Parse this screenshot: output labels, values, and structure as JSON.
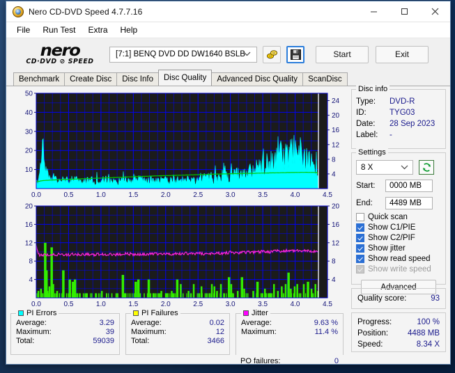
{
  "window": {
    "title": "Nero CD-DVD Speed 4.7.7.16",
    "icon": "nero-disc-icon",
    "minimize": "minimize-icon",
    "maximize": "maximize-icon",
    "close": "close-icon"
  },
  "menu": [
    {
      "label": "File"
    },
    {
      "label": "Run Test"
    },
    {
      "label": "Extra"
    },
    {
      "label": "Help"
    }
  ],
  "toolbar": {
    "logo_word": "nero",
    "logo_sub": "CD·DVD ⊘ SPEED",
    "drive": "[7:1]   BENQ DVD DD DW1640 BSLB",
    "eject_icon": "eject-disc-icon",
    "save_icon": "floppy-save-icon",
    "start_label": "Start",
    "exit_label": "Exit"
  },
  "tabs": [
    {
      "label": "Benchmark",
      "active": false
    },
    {
      "label": "Create Disc",
      "active": false
    },
    {
      "label": "Disc Info",
      "active": false
    },
    {
      "label": "Disc Quality",
      "active": true
    },
    {
      "label": "Advanced Disc Quality",
      "active": false
    },
    {
      "label": "ScanDisc",
      "active": false
    }
  ],
  "disc_info": {
    "title": "Disc info",
    "rows": [
      {
        "key": "Type:",
        "value": "DVD-R"
      },
      {
        "key": "ID:",
        "value": "TYG03"
      },
      {
        "key": "Date:",
        "value": "28 Sep 2023"
      },
      {
        "key": "Label:",
        "value": "-"
      }
    ]
  },
  "settings": {
    "title": "Settings",
    "speed": "8 X",
    "refresh_icon": "refresh-arrows-icon",
    "start_label": "Start:",
    "start_value": "0000 MB",
    "end_label": "End:",
    "end_value": "4489 MB",
    "checkboxes": [
      {
        "label": "Quick scan",
        "checked": false,
        "disabled": false
      },
      {
        "label": "Show C1/PIE",
        "checked": true,
        "disabled": false
      },
      {
        "label": "Show C2/PIF",
        "checked": true,
        "disabled": false
      },
      {
        "label": "Show jitter",
        "checked": true,
        "disabled": false
      },
      {
        "label": "Show read speed",
        "checked": true,
        "disabled": false
      },
      {
        "label": "Show write speed",
        "checked": true,
        "disabled": true
      }
    ],
    "advanced_label": "Advanced"
  },
  "quality": {
    "label": "Quality score:",
    "value": "93"
  },
  "progress": {
    "rows": [
      {
        "key": "Progress:",
        "value": "100 %"
      },
      {
        "key": "Position:",
        "value": "4488 MB"
      },
      {
        "key": "Speed:",
        "value": "8.34 X"
      }
    ]
  },
  "stats": {
    "pi_errors": {
      "title": "PI Errors",
      "color": "#00ffff",
      "rows": [
        {
          "key": "Average:",
          "value": "3.29"
        },
        {
          "key": "Maximum:",
          "value": "39"
        },
        {
          "key": "Total:",
          "value": "59039"
        }
      ]
    },
    "pi_failures": {
      "title": "PI Failures",
      "color": "#ffff00",
      "rows": [
        {
          "key": "Average:",
          "value": "0.02"
        },
        {
          "key": "Maximum:",
          "value": "12"
        },
        {
          "key": "Total:",
          "value": "3466"
        }
      ]
    },
    "jitter": {
      "title": "Jitter",
      "color": "#ff00ff",
      "rows": [
        {
          "key": "Average:",
          "value": "9.63 %"
        },
        {
          "key": "Maximum:",
          "value": "11.4 %"
        }
      ],
      "po_key": "PO failures:",
      "po_value": "0"
    }
  },
  "chart_data": [
    {
      "type": "area",
      "name": "pi-errors-chart",
      "title": "",
      "xlabel": "",
      "ylabel": "PI Errors",
      "xlim": [
        0.0,
        4.5
      ],
      "ylim": [
        0,
        50
      ],
      "y2lim": [
        0,
        26
      ],
      "xticks": [
        0.0,
        0.5,
        1.0,
        1.5,
        2.0,
        2.5,
        3.0,
        3.5,
        4.0,
        4.5
      ],
      "yticks": [
        10,
        20,
        30,
        40,
        50
      ],
      "y2ticks": [
        4,
        8,
        12,
        16,
        20,
        24
      ],
      "grid": true,
      "bg": "#1b1b1b",
      "grid_color": "#0000ff",
      "scan_end_x": 4.36,
      "series": [
        {
          "name": "PI Errors",
          "color": "#00ffff",
          "kind": "area",
          "x": [
            0.0,
            0.04,
            0.07,
            0.1,
            0.12,
            0.14,
            0.16,
            0.19,
            0.23,
            0.27,
            0.31,
            0.36,
            0.42,
            0.48,
            0.55,
            0.62,
            0.7,
            0.78,
            0.86,
            0.94,
            1.02,
            1.1,
            1.18,
            1.26,
            1.34,
            1.42,
            1.5,
            1.58,
            1.66,
            1.74,
            1.82,
            1.9,
            1.98,
            2.06,
            2.14,
            2.22,
            2.3,
            2.38,
            2.46,
            2.54,
            2.62,
            2.7,
            2.78,
            2.86,
            2.94,
            3.02,
            3.1,
            3.18,
            3.26,
            3.34,
            3.42,
            3.5,
            3.58,
            3.66,
            3.74,
            3.82,
            3.86,
            3.9,
            3.98,
            4.02,
            4.06,
            4.1,
            4.14,
            4.18,
            4.22,
            4.26,
            4.3,
            4.34,
            4.36
          ],
          "y": [
            2,
            5,
            11,
            20,
            13,
            9,
            7,
            6,
            5,
            5,
            4,
            4,
            4,
            4,
            4,
            4,
            4,
            4,
            4,
            4,
            4,
            4,
            4,
            4,
            4,
            4,
            4,
            4,
            4,
            4,
            4,
            4,
            4,
            4,
            4,
            4,
            4,
            4,
            4,
            5,
            5,
            5,
            5,
            6,
            6,
            6,
            7,
            7,
            8,
            9,
            10,
            11,
            12,
            13,
            15,
            18,
            16,
            17,
            19,
            20,
            18,
            17,
            16,
            14,
            13,
            12,
            11,
            9,
            7
          ]
        },
        {
          "name": "Read speed",
          "color": "#00cc00",
          "kind": "line",
          "x": [
            0.0,
            0.1,
            0.3,
            0.6,
            0.9,
            1.2,
            1.5,
            1.8,
            2.1,
            2.4,
            2.7,
            3.0,
            3.3,
            3.6,
            3.9,
            4.1,
            4.25,
            4.34,
            4.36
          ],
          "y": [
            3.5,
            4.2,
            4.6,
            5.0,
            5.4,
            5.8,
            6.2,
            6.6,
            6.9,
            7.2,
            7.5,
            7.8,
            8.0,
            8.2,
            8.4,
            8.5,
            8.5,
            8.4,
            7.2
          ]
        }
      ]
    },
    {
      "type": "bar",
      "name": "pi-failures-jitter-chart",
      "title": "",
      "xlabel": "",
      "ylabel": "PI Failures",
      "xlim": [
        0.0,
        4.5
      ],
      "ylim": [
        0,
        20
      ],
      "xticks": [
        0.0,
        0.5,
        1.0,
        1.5,
        2.0,
        2.5,
        3.0,
        3.5,
        4.0,
        4.5
      ],
      "yticks": [
        4,
        8,
        12,
        16,
        20
      ],
      "grid": true,
      "bg": "#1b1b1b",
      "grid_color": "#0000ff",
      "scan_end_x": 4.36,
      "series": [
        {
          "name": "PI Failures",
          "color": "#33ee00",
          "kind": "bar",
          "x": [
            0.02,
            0.06,
            0.09,
            0.12,
            0.14,
            0.16,
            0.19,
            0.22,
            0.25,
            0.28,
            0.31,
            0.35,
            0.4,
            0.46,
            0.5,
            0.55,
            0.58,
            0.62,
            0.67,
            0.72,
            0.78,
            0.85,
            0.92,
            1.0,
            1.08,
            1.16,
            1.24,
            1.32,
            1.36,
            1.44,
            1.52,
            1.56,
            1.6,
            1.66,
            1.72,
            1.76,
            1.84,
            1.92,
            2.0,
            2.08,
            2.16,
            2.22,
            2.26,
            2.34,
            2.42,
            2.5,
            2.54,
            2.62,
            2.7,
            2.74,
            2.78,
            2.84,
            2.9,
            2.96,
            3.0,
            3.04,
            3.1,
            3.16,
            3.2,
            3.26,
            3.34,
            3.4,
            3.48,
            3.52,
            3.6,
            3.66,
            3.72,
            3.78,
            3.84,
            3.88,
            3.92,
            3.98,
            4.02,
            4.06,
            4.12,
            4.18,
            4.24,
            4.3,
            4.34
          ],
          "y": [
            1.5,
            2.0,
            1.0,
            12.0,
            6.0,
            1.5,
            2.5,
            11.0,
            3.0,
            1.0,
            1.5,
            1.0,
            6.0,
            1.0,
            4.0,
            3.5,
            4.0,
            1.0,
            1.0,
            1.0,
            1.0,
            1.0,
            1.0,
            1.5,
            1.0,
            1.0,
            1.0,
            5.0,
            1.0,
            1.0,
            3.5,
            4.0,
            1.0,
            1.0,
            4.0,
            1.0,
            1.0,
            1.5,
            1.0,
            1.5,
            4.0,
            3.0,
            1.0,
            1.5,
            3.0,
            1.0,
            2.5,
            1.0,
            3.0,
            2.5,
            1.5,
            3.0,
            1.0,
            4.5,
            3.0,
            1.0,
            1.5,
            4.5,
            2.0,
            1.0,
            1.5,
            3.5,
            1.0,
            2.0,
            1.0,
            3.0,
            1.5,
            2.5,
            3.0,
            5.5,
            2.0,
            2.5,
            3.0,
            1.0,
            3.0,
            3.5,
            2.0,
            3.0,
            1.5
          ]
        },
        {
          "name": "Jitter",
          "color": "#ff22dd",
          "kind": "line",
          "x": [
            0.0,
            0.03,
            0.06,
            0.09,
            0.12,
            0.16,
            0.2,
            0.25,
            0.3,
            0.4,
            0.5,
            0.6,
            0.7,
            0.8,
            0.9,
            1.0,
            1.1,
            1.2,
            1.3,
            1.4,
            1.5,
            1.6,
            1.7,
            1.8,
            1.9,
            2.0,
            2.1,
            2.2,
            2.3,
            2.4,
            2.5,
            2.6,
            2.7,
            2.8,
            2.9,
            3.0,
            3.1,
            3.2,
            3.3,
            3.4,
            3.5,
            3.6,
            3.7,
            3.8,
            3.9,
            4.0,
            4.1,
            4.2,
            4.3,
            4.36
          ],
          "y": [
            11.2,
            9.6,
            9.3,
            9.2,
            9.4,
            9.3,
            9.4,
            9.5,
            9.4,
            9.5,
            9.4,
            9.5,
            9.4,
            9.5,
            9.4,
            9.5,
            9.5,
            9.4,
            9.5,
            9.6,
            9.5,
            9.4,
            9.5,
            9.6,
            9.5,
            9.6,
            9.5,
            9.6,
            9.7,
            9.6,
            9.7,
            9.6,
            9.7,
            9.8,
            9.7,
            9.9,
            9.8,
            9.9,
            10.0,
            9.9,
            10.1,
            10.0,
            10.2,
            10.1,
            10.3,
            10.2,
            10.3,
            10.2,
            10.1,
            10.0
          ]
        }
      ]
    }
  ]
}
